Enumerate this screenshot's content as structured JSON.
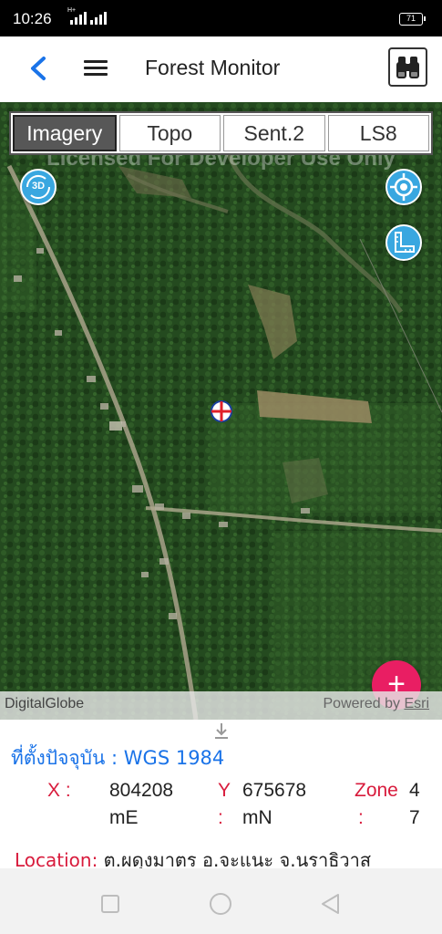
{
  "status_bar": {
    "time": "10:26",
    "network": "H+",
    "battery": "71"
  },
  "app_bar": {
    "title": "Forest Monitor",
    "icons": [
      "back-arrow-icon",
      "menu-icon",
      "binoculars-icon"
    ],
    "accent": "#1a73e8"
  },
  "map": {
    "watermark": "Licensed For Developer Use Only",
    "layer_tabs": [
      {
        "label": "Imagery",
        "active": true
      },
      {
        "label": "Topo",
        "active": false
      },
      {
        "label": "Sent.2",
        "active": false
      },
      {
        "label": "LS8",
        "active": false
      }
    ],
    "btn_3d_label": "3D",
    "attribution_left": "DigitalGlobe",
    "attribution_prefix": "Powered by ",
    "attribution_esri": "Esri",
    "fab_label": "+",
    "fab_color": "#e91e63"
  },
  "info": {
    "current_location": "ที่ตั้งปัจจุบัน : WGS 1984",
    "x_label": "X :",
    "x_value": "804208",
    "x_unit": "mE",
    "y_label": "Y",
    "y_colon": ":",
    "y_value": "675678",
    "y_unit": "mN",
    "zone_label": "Zone",
    "zone_colon": ":",
    "zone_value_1": "4",
    "zone_value_2": "7",
    "location_label": "Location:",
    "location_value": " ต.ผดุงมาตร อ.จะแนะ จ.นราธิวาส"
  }
}
